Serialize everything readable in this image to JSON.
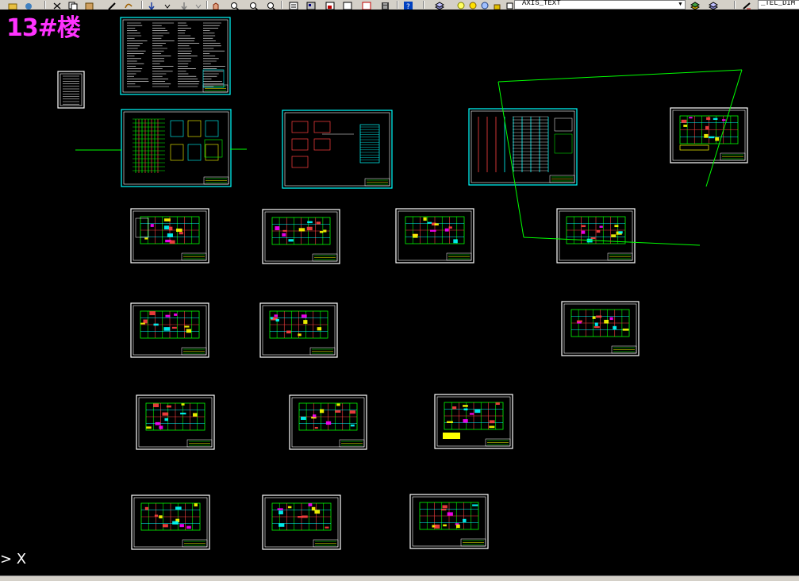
{
  "toolbar": {
    "layer_combo_value": "AXIS_TEXT",
    "text_style_value": "_TEL_DIM",
    "icons": [
      "open-icon",
      "save-icon",
      "cut-icon",
      "copy-icon",
      "paste-icon",
      "matchprop-icon",
      "undo-icon",
      "redo-icon",
      "pan-icon",
      "zoom-realtime-icon",
      "zoom-window-icon",
      "zoom-previous-icon",
      "properties-icon",
      "designcenter-icon",
      "toolpalette-icon",
      "sheetset-icon",
      "markup-icon",
      "calculator-icon",
      "help-icon",
      "layer-manager-icon",
      "layer-state-icon",
      "layer-previous-icon"
    ]
  },
  "canvas": {
    "title_text": "13#楼",
    "ucs_label": "> X",
    "colors": {
      "background": "#000000",
      "sheet_border": "#ffffff",
      "sheet_border_alt": "#00ffff",
      "title_magenta": "#ff33ff",
      "green_line": "#00ff00"
    }
  }
}
